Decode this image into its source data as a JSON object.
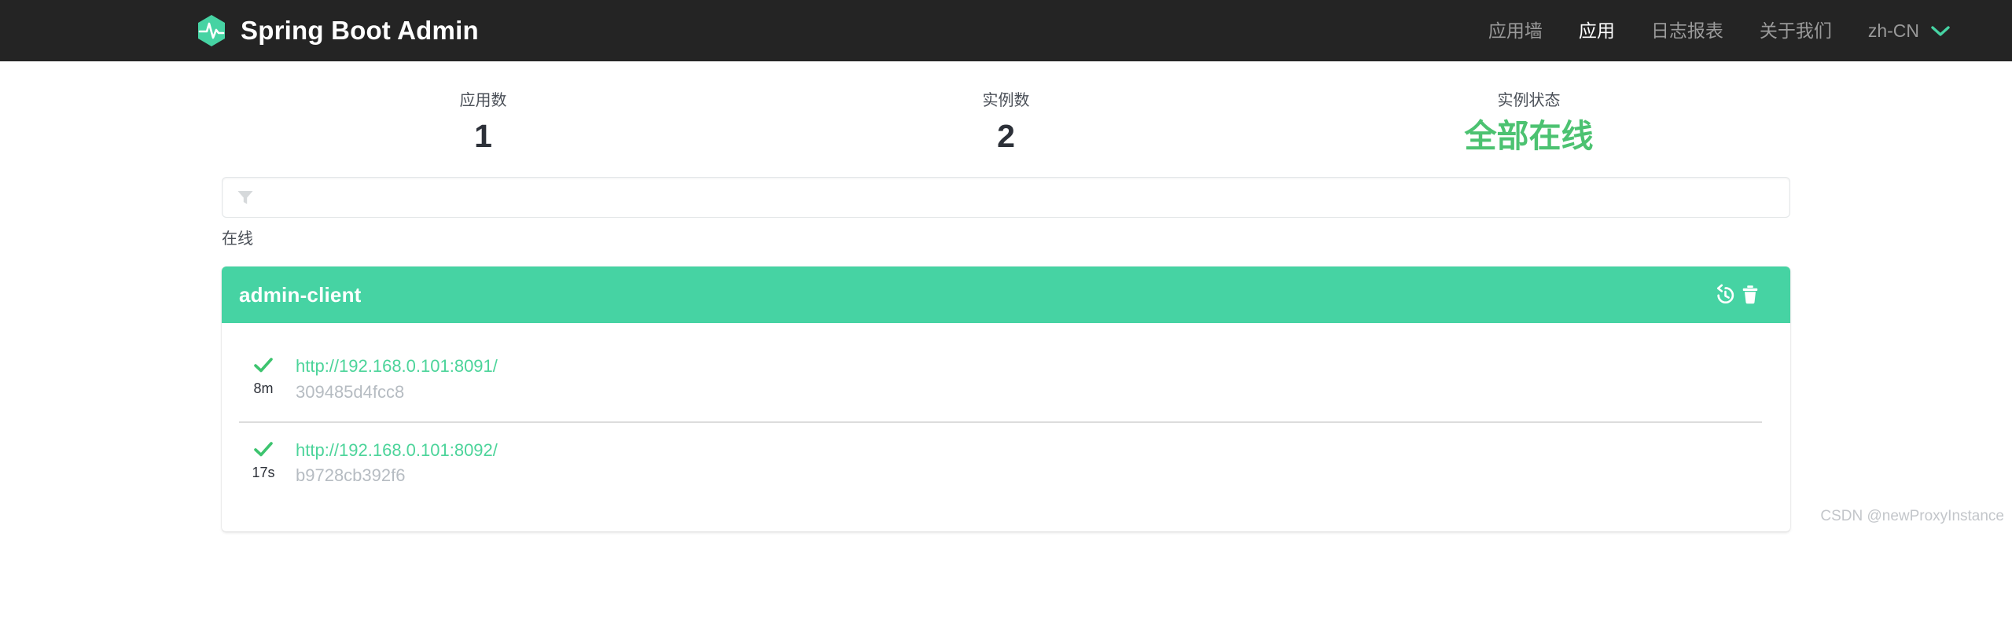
{
  "navbar": {
    "brand_title": "Spring Boot Admin",
    "logo_icon": "heartbeat-hexagon-logo",
    "links": [
      {
        "label": "应用墙",
        "active": false
      },
      {
        "label": "应用",
        "active": true
      },
      {
        "label": "日志报表",
        "active": false
      },
      {
        "label": "关于我们",
        "active": false
      }
    ],
    "language": {
      "label": "zh-CN",
      "chevron_icon": "chevron-down-icon"
    }
  },
  "stats": [
    {
      "label": "应用数",
      "value": "1",
      "highlight": false
    },
    {
      "label": "实例数",
      "value": "2",
      "highlight": false
    },
    {
      "label": "实例状态",
      "value": "全部在线",
      "highlight": true
    }
  ],
  "filter": {
    "icon": "funnel-icon",
    "value": "",
    "placeholder": ""
  },
  "filter_hint": "在线",
  "application": {
    "name": "admin-client",
    "actions": [
      {
        "icon": "history-restore-icon",
        "name": "restore"
      },
      {
        "icon": "trash-delete-icon",
        "name": "delete"
      }
    ],
    "instances": [
      {
        "status_icon": "check-icon",
        "uptime": "8m",
        "url": "http://192.168.0.101:8091/",
        "id": "309485d4fcc8"
      },
      {
        "status_icon": "check-icon",
        "uptime": "17s",
        "url": "http://192.168.0.101:8092/",
        "id": "b9728cb392f6"
      }
    ]
  },
  "watermark": "CSDN @newProxyInstance",
  "colors": {
    "navbar_bg": "#242424",
    "brand_green": "#46d3a3",
    "status_green": "#4cc271",
    "link_green": "#4cd49a",
    "muted_text": "#b6bcc2"
  }
}
